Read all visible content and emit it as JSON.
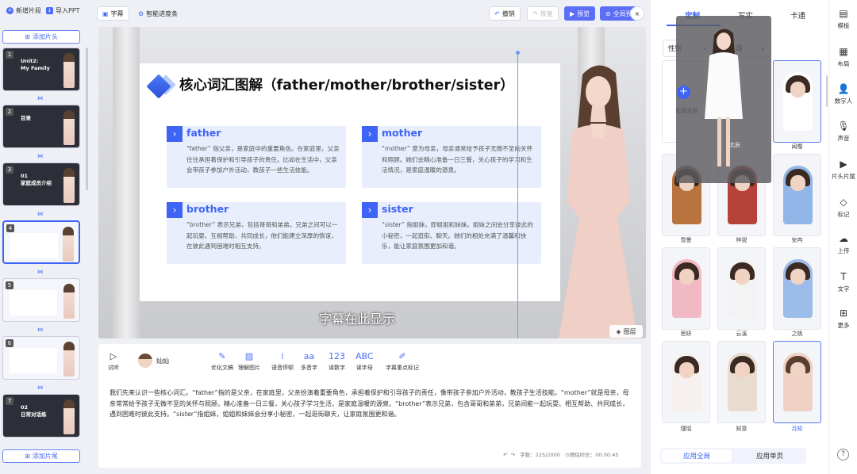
{
  "left": {
    "new_segment": "新增片段",
    "import_ppt": "导入PPT",
    "add_intro": "添加片头",
    "add_outro": "添加片尾",
    "slides": [
      {
        "num": "1",
        "title_line1": "Unit2:",
        "title_line2": "My Family",
        "theme": "dark"
      },
      {
        "num": "2",
        "title_line1": "目录",
        "title_line2": "",
        "theme": "dark"
      },
      {
        "num": "3",
        "title_line1": "01",
        "title_line2": "家庭成员介绍",
        "theme": "dark"
      },
      {
        "num": "4",
        "title_line1": "",
        "title_line2": "",
        "theme": "light"
      },
      {
        "num": "5",
        "title_line1": "",
        "title_line2": "",
        "theme": "light"
      },
      {
        "num": "6",
        "title_line1": "",
        "title_line2": "",
        "theme": "light"
      },
      {
        "num": "7",
        "title_line1": "02",
        "title_line2": "日常对话练",
        "theme": "dark"
      }
    ]
  },
  "toolbar": {
    "subtitle": "字幕",
    "smart_progress": "智能进度条",
    "undo": "撤销",
    "redo": "恢复",
    "preview": "预览",
    "full_preview": "全局预",
    "close": "×"
  },
  "slide": {
    "title": "核心词汇图解（father/mother/brother/sister）",
    "words": [
      {
        "word": "father",
        "desc": "“father” 指父亲，是家庭中的重要角色。在家庭里，父亲往往承担着保护和引导孩子的责任。比如在生活中，父亲会带孩子参加户外活动，教孩子一些生活技能。"
      },
      {
        "word": "mother",
        "desc": "“mother” 意为母亲，母亲通常给予孩子无微不至的关怀和照顾。她们会精心准备一日三餐，关心孩子的学习和生活情况，是家庭温暖的源泉。"
      },
      {
        "word": "brother",
        "desc": "“brother” 表示兄弟，包括哥哥和弟弟。兄弟之间可以一起玩耍、互相帮助、共同成长，他们能建立深厚的情谊，在彼此遇到困难时相互支持。"
      },
      {
        "word": "sister",
        "desc": "“sister” 指姐妹，即姐姐和妹妹。姐妹之间会分享彼此的小秘密，一起逛街、聊天。她们的相处充满了温馨和快乐，能让家庭氛围更加和谐。"
      }
    ]
  },
  "stage": {
    "subtitle_placeholder": "字幕在此显示",
    "layers": "图层"
  },
  "editor": {
    "audition": "试听",
    "voice_name": "灿灿",
    "tools": [
      "优化文稿",
      "理解图片",
      "语音停顿",
      "多音字",
      "读数字",
      "读字母",
      "字幕重点标记"
    ],
    "script": "我们先来认识一些核心词汇。“father”指的是父亲，在家庭里，父亲扮演着重要角色，承担着保护和引导孩子的责任，像带孩子参加户外活动，教孩子生活技能。“mother”就是母亲，母亲常常给予孩子无微不至的关怀与照顾，精心准备一日三餐，关心孩子学习生活，是家庭温暖的源泉。“brother”表示兄弟，包含哥哥和弟弟，兄弟间能一起玩耍、相互帮助、共同成长，遇到困难时彼此支持。“sister”指姐妹，姐姐和妹妹会分享小秘密，一起逛街聊天，让家庭氛围更和谐。",
    "char_count_label": "字数：",
    "char_count": "225/2000",
    "duration_label": "预估时长：",
    "duration": "00:00:45"
  },
  "right": {
    "tabs": [
      "定制",
      "写实",
      "卡通"
    ],
    "filter_gender": "性别",
    "filter_other": "场",
    "custom_label": "形象定制",
    "avatars": [
      {
        "name": "北辰"
      },
      {
        "name": "闻樱"
      },
      {
        "name": "雪曼"
      },
      {
        "name": "梓锐"
      },
      {
        "name": "安冉"
      },
      {
        "name": "思妍"
      },
      {
        "name": "云溪"
      },
      {
        "name": "之桃"
      },
      {
        "name": "瑾瑶"
      },
      {
        "name": "知意"
      },
      {
        "name": "月知"
      }
    ],
    "apply_all": "应用全局",
    "apply_page": "应用单页"
  },
  "far": {
    "items": [
      "模板",
      "布局",
      "数字人",
      "声音",
      "片头片尾",
      "标记",
      "上传",
      "文字",
      "更多"
    ],
    "help": "?"
  },
  "colors": {
    "accent": "#3d64f5",
    "brand_button": "#5b6ef5"
  }
}
